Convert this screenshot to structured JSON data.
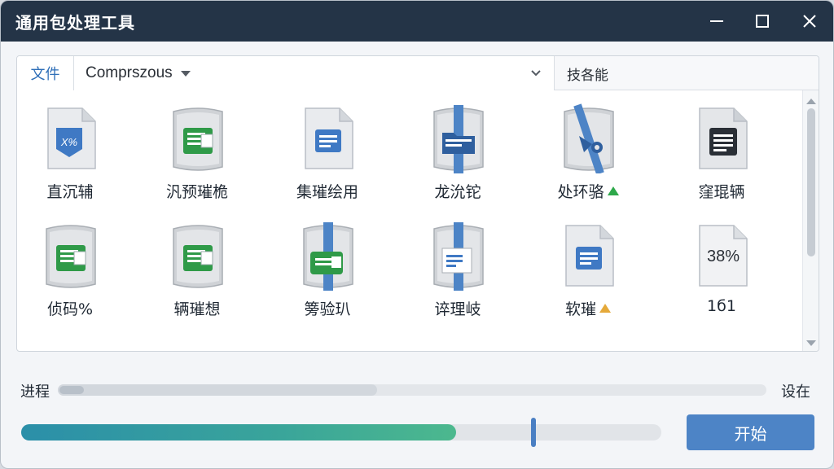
{
  "window": {
    "title": "通用包处理工具"
  },
  "toolbar": {
    "file_tab": "文件",
    "combo_value": "Comprszous",
    "tool_label": "技各能"
  },
  "files": [
    {
      "label": "直沉辅",
      "icon": "x-percent-document-icon",
      "mark": ""
    },
    {
      "label": "汎预璀桅",
      "icon": "green-spreadsheet-package-icon",
      "mark": ""
    },
    {
      "label": "集璀绘用",
      "icon": "blue-document-icon",
      "mark": ""
    },
    {
      "label": "龙沇铊",
      "icon": "blue-folder-package-icon",
      "mark": ""
    },
    {
      "label": "处环骆",
      "icon": "blue-tool-package-icon",
      "mark": "green"
    },
    {
      "label": "窪琨辆",
      "icon": "text-document-icon",
      "mark": ""
    },
    {
      "label": "侦码%",
      "icon": "green-spreadsheet-package-icon",
      "mark": ""
    },
    {
      "label": "辆璀想",
      "icon": "green-spreadsheet-package-icon",
      "mark": ""
    },
    {
      "label": "篣验玐",
      "icon": "green-strapped-package-icon",
      "mark": ""
    },
    {
      "label": "谇理岐",
      "icon": "blue-strapped-document-icon",
      "mark": ""
    },
    {
      "label": "软璀",
      "icon": "blue-document-icon",
      "mark": "amber"
    },
    {
      "label": "1б1",
      "icon": "percent-document-icon",
      "mark": "",
      "icon_text": "38%"
    }
  ],
  "progress": {
    "label": "进程",
    "value": 0.45,
    "settings_label": "设在"
  },
  "slider": {
    "value": 0.68,
    "handle_position": 0.8
  },
  "actions": {
    "start_label": "开始"
  },
  "colors": {
    "titlebar": "#243447",
    "accent": "#4d84c6",
    "fill_start": "#2b8fa9",
    "fill_end": "#4cb88e"
  }
}
